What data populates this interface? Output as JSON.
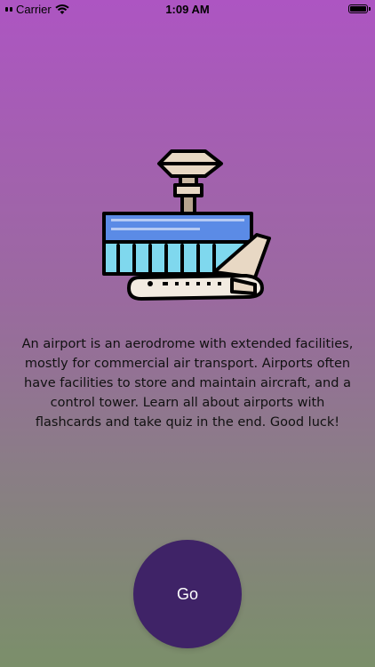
{
  "status_bar": {
    "carrier": "Carrier",
    "time": "1:09 AM"
  },
  "illustration": {
    "icon": "airport-illustration-icon"
  },
  "description": {
    "text": "An airport is an aerodrome with extended facilities, mostly for commercial air transport. Airports often have facilities to store and maintain aircraft, and a control tower. Learn all about airports with flashcards and take quiz in the end. Good luck!"
  },
  "go_button": {
    "label": "Go"
  },
  "colors": {
    "gradient_top": "#ad55c2",
    "gradient_bottom": "#7b8f6a",
    "button": "#3f2367"
  }
}
